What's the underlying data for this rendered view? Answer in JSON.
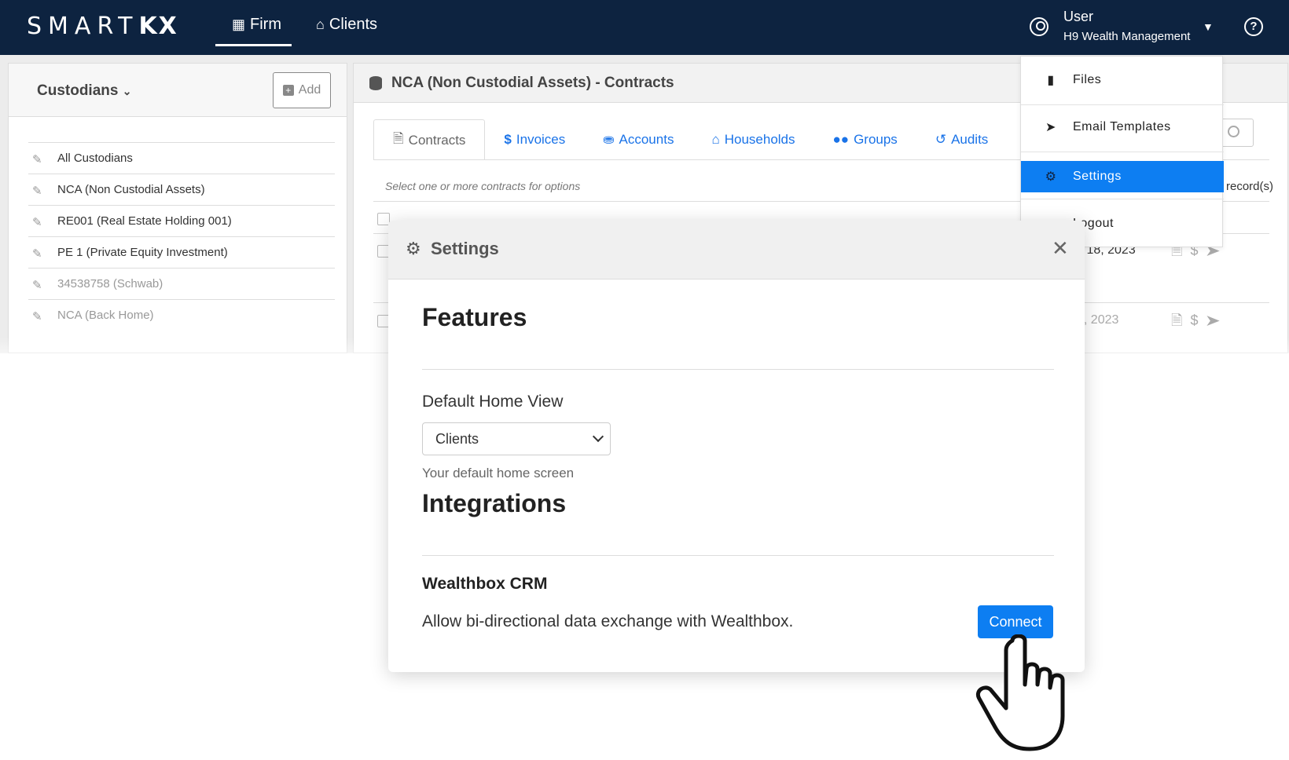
{
  "navbar": {
    "logo_thin": "SMART",
    "logo_bold": "KX",
    "firm": "Firm",
    "clients": "Clients",
    "user_name": "User",
    "user_firm": "H9 Wealth Management"
  },
  "custodians": {
    "title": "Custodians",
    "add_label": "Add",
    "items": [
      {
        "label": "All Custodians"
      },
      {
        "label": "NCA (Non Custodial Assets)"
      },
      {
        "label": "RE001 (Real Estate Holding 001)"
      },
      {
        "label": "PE 1 (Private Equity Investment)"
      },
      {
        "label": "34538758 (Schwab)"
      },
      {
        "label": "NCA (Back Home)"
      }
    ]
  },
  "main": {
    "title": "NCA (Non Custodial Assets) - Contracts",
    "tabs": [
      {
        "label": "Contracts",
        "icon": "document-icon"
      },
      {
        "label": "Invoices",
        "icon": "dollar-icon"
      },
      {
        "label": "Accounts",
        "icon": "database-icon"
      },
      {
        "label": "Households",
        "icon": "house-icon"
      },
      {
        "label": "Groups",
        "icon": "users-icon"
      },
      {
        "label": "Audits",
        "icon": "history-icon"
      }
    ],
    "hint": "Select one or more contracts for options",
    "records": "record(s)",
    "rows": [
      {
        "date": "y 18, 2023"
      },
      {
        "date": "6, 2023"
      }
    ]
  },
  "user_menu": {
    "items": [
      {
        "label": "Files",
        "icon": "file-icon"
      },
      {
        "label": "Email Templates",
        "icon": "paper-plane-icon"
      },
      {
        "label": "Settings",
        "icon": "gear-icon",
        "active": true
      },
      {
        "label": "Logout",
        "icon": "logout-icon"
      }
    ]
  },
  "modal": {
    "title": "Settings",
    "features_title": "Features",
    "default_home_label": "Default Home View",
    "default_home_value": "Clients",
    "default_home_help": "Your default home screen",
    "integrations_title": "Integrations",
    "crm_name": "Wealthbox CRM",
    "crm_description": "Allow bi-directional data exchange with Wealthbox.",
    "connect_label": "Connect"
  },
  "colors": {
    "navbar": "#0d2340",
    "primary": "#0d7ef2",
    "link": "#1a73e8"
  }
}
